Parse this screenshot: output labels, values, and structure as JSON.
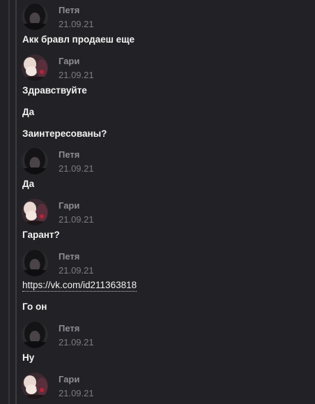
{
  "messages": [
    {
      "author": "Петя",
      "date": "21.09.21",
      "lines": [
        "Акк бравл продаеш еще"
      ]
    },
    {
      "author": "Гари",
      "date": "21.09.21",
      "lines": [
        "Здравствуйте",
        "Да",
        "Заинтересованы?"
      ]
    },
    {
      "author": "Петя",
      "date": "21.09.21",
      "lines": [
        "Да"
      ]
    },
    {
      "author": "Гари",
      "date": "21.09.21",
      "lines": [
        "Гарант?"
      ]
    },
    {
      "author": "Петя",
      "date": "21.09.21",
      "link": "https://vk.com/id211363818",
      "lines": [
        "Го он"
      ]
    },
    {
      "author": "Петя",
      "date": "21.09.21",
      "lines": [
        "Ну"
      ]
    },
    {
      "author": "Гари",
      "date": "21.09.21",
      "lines": []
    }
  ],
  "colors": {
    "background": "#222226",
    "author": "#8d8d93",
    "date": "#7b7b81",
    "text": "#f2f2f2"
  },
  "icons": {
    "petya_avatar": "user-avatar-dark",
    "gari_avatar": "user-avatar-pink"
  }
}
